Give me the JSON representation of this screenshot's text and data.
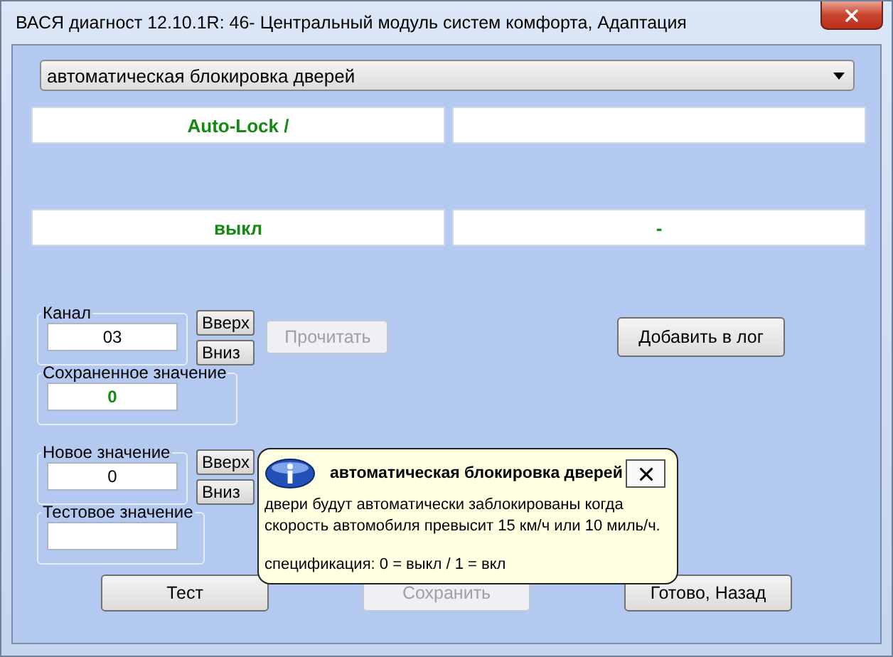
{
  "window": {
    "title": "ВАСЯ диагност 12.10.1R: 46- Центральный модуль систем комфорта, Адаптация"
  },
  "parameter_dropdown": {
    "value": "автоматическая блокировка дверей"
  },
  "value_boxes": {
    "top_left": "Auto-Lock /",
    "bottom_left": "выкл",
    "bottom_right": "-"
  },
  "channel": {
    "label": "Канал",
    "value": "03",
    "up": "Вверх",
    "down": "Вниз"
  },
  "read_button": {
    "label": "Прочитать",
    "disabled": true
  },
  "log_button": {
    "label": "Добавить в лог",
    "disabled": false
  },
  "saved_value": {
    "label": "Сохраненное значение",
    "value": "0"
  },
  "new_value": {
    "label": "Новое значение",
    "value": "0",
    "up": "Вверх",
    "down": "Вниз"
  },
  "test_value": {
    "label": "Тестовое значение"
  },
  "buttons": [
    {
      "label": "Тест",
      "disabled": false
    },
    {
      "label": "Сохранить",
      "disabled": true
    },
    {
      "label": "Готово, Назад",
      "disabled": false
    }
  ],
  "tooltip": {
    "title": "автоматическая блокировка дверей",
    "lines": [
      "двери будут автоматически заблокированы когда",
      "скорость автомобиля превысит 15 км/ч или 10 миль/ч."
    ],
    "spec": "спецификация: 0 = выкл / 1 = вкл"
  }
}
